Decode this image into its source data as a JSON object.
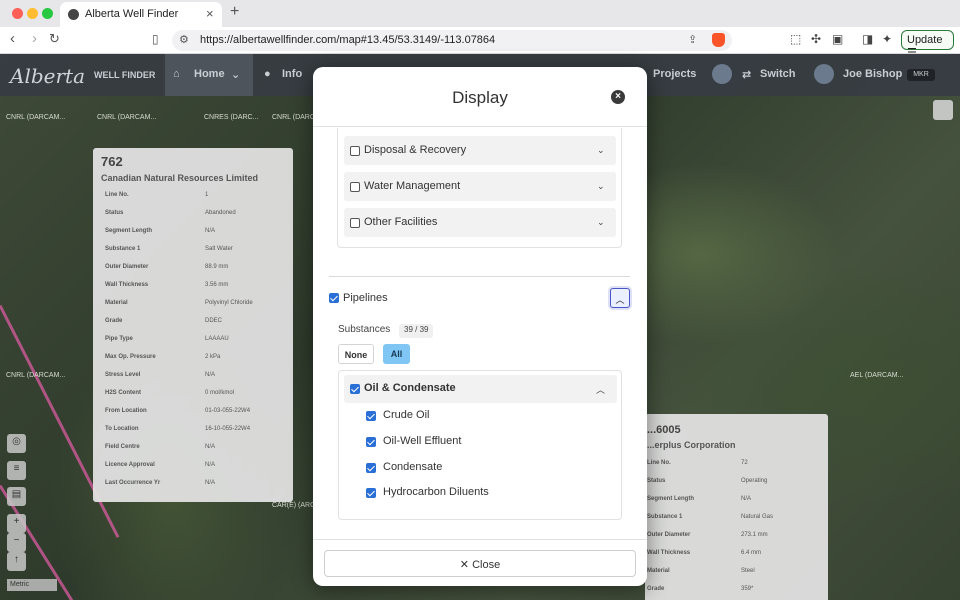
{
  "browser": {
    "tab_title": "Alberta Well Finder",
    "tab_close": "×",
    "new_tab": "+",
    "url": "https://albertawellfinder.com/map#13.45/53.3149/-113.07864",
    "update_label": "Update",
    "icons": [
      "back-icon",
      "forward-icon",
      "reload-icon",
      "bookmark-icon",
      "site-settings-icon",
      "share-icon",
      "brave-shield-icon",
      "screenshot-icon",
      "extensions-icon",
      "wallet-icon",
      "sidebar-icon",
      "leo-icon",
      "menu-icon"
    ]
  },
  "app_nav": {
    "logo": "Alberta",
    "product": "WELL FINDER",
    "home": "Home",
    "info": "Info",
    "projects": "Projects",
    "switch": "Switch",
    "user": "Joe Bishop",
    "user_badge": "MKR"
  },
  "map": {
    "labels": [
      "CNRL (DARCAM...",
      "CNRL (DARCAM...",
      "CNRES (DARC...",
      "CNRL (DARCAM...",
      "AEL (DARCAM...",
      "CNRL (DARCAM...",
      "CAR(E) (ARC..."
    ],
    "scale": "Metric",
    "left_card": {
      "id": "762",
      "company": "Canadian Natural Resources Limited",
      "rows": [
        {
          "k": "Line No.",
          "v": "1"
        },
        {
          "k": "Status",
          "v": "Abandoned"
        },
        {
          "k": "Segment Length",
          "v": "N/A"
        },
        {
          "k": "Substance 1",
          "v": "Salt Water"
        },
        {
          "k": "Outer Diameter",
          "v": "88.9 mm"
        },
        {
          "k": "Wall Thickness",
          "v": "3.56 mm"
        },
        {
          "k": "Material",
          "v": "Polyvinyl Chloride"
        },
        {
          "k": "Grade",
          "v": "DDEC"
        },
        {
          "k": "Pipe Type",
          "v": "LAAAAU"
        },
        {
          "k": "Max Op. Pressure",
          "v": "2 kPa"
        },
        {
          "k": "Stress Level",
          "v": "N/A"
        },
        {
          "k": "H2S Content",
          "v": "0 mol/kmol"
        },
        {
          "k": "From Location",
          "v": "01-03-055-22W4"
        },
        {
          "k": "To Location",
          "v": "16-10-055-22W4"
        },
        {
          "k": "Field Centre",
          "v": "N/A"
        },
        {
          "k": "Licence Approval",
          "v": "N/A"
        },
        {
          "k": "Last Occurrence Yr",
          "v": "N/A"
        }
      ]
    },
    "right_card": {
      "id": "...6005",
      "company": "...erplus Corporation",
      "rows": [
        {
          "k": "Line No.",
          "v": "72"
        },
        {
          "k": "Status",
          "v": "Operating"
        },
        {
          "k": "Segment Length",
          "v": "N/A"
        },
        {
          "k": "Substance 1",
          "v": "Natural Gas"
        },
        {
          "k": "Outer Diameter",
          "v": "273.1 mm"
        },
        {
          "k": "Wall Thickness",
          "v": "6.4 mm"
        },
        {
          "k": "Material",
          "v": "Steel"
        },
        {
          "k": "Grade",
          "v": "359*"
        }
      ]
    }
  },
  "modal": {
    "title": "Display",
    "facilities": [
      {
        "label": "Disposal & Recovery",
        "checked": false
      },
      {
        "label": "Water Management",
        "checked": false
      },
      {
        "label": "Other Facilities",
        "checked": false
      }
    ],
    "pipelines": {
      "label": "Pipelines",
      "checked": true,
      "substances_label": "Substances",
      "substances_count": "39 / 39",
      "none_label": "None",
      "all_label": "All",
      "group": {
        "label": "Oil & Condensate",
        "checked": true,
        "items": [
          {
            "label": "Crude Oil",
            "checked": true
          },
          {
            "label": "Oil-Well Effluent",
            "checked": true
          },
          {
            "label": "Condensate",
            "checked": true
          },
          {
            "label": "Hydrocarbon Diluents",
            "checked": true
          }
        ]
      }
    },
    "close_label": "✕  Close"
  },
  "colors": {
    "accent": "#2a6fd6",
    "all_button": "#7fc6f5",
    "pipeline_line": "#d05a9a",
    "update_border": "#2a7a3a"
  }
}
